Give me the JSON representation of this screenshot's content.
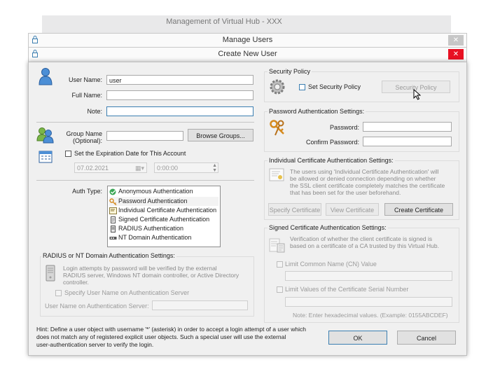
{
  "windows": {
    "bg_title": "Management of Virtual Hub - XXX",
    "mid_title": "Manage Users",
    "dialog_title": "Create New User",
    "close_glyph": "✕"
  },
  "user": {
    "user_name_label": "User Name:",
    "user_name_value": "user",
    "full_name_label": "Full Name:",
    "full_name_value": "",
    "note_label": "Note:",
    "note_value": ""
  },
  "group": {
    "label_line1": "Group Name",
    "label_line2": "(Optional):",
    "value": "",
    "browse_label": "Browse Groups..."
  },
  "expiration": {
    "checkbox_label": "Set the Expiration Date for This Account",
    "date": "07.02.2021",
    "time": "0:00:00"
  },
  "auth": {
    "label": "Auth Type:",
    "options": [
      "Anonymous Authentication",
      "Password Authentication",
      "Individual Certificate Authentication",
      "Signed Certificate Authentication",
      "RADIUS Authentication",
      "NT Domain Authentication"
    ]
  },
  "radius": {
    "group_title": "RADIUS or NT Domain Authentication Settings:",
    "description": [
      "Login attempts by password will be verified by the external",
      "RADIUS server, Windows NT domain controller, or Active Directory",
      "controller."
    ],
    "specify_label": "Specify User Name on Authentication Server",
    "user_label": "User Name on Authentication Server:"
  },
  "hint": {
    "lines": [
      "Hint: Define a user object with username '*' (asterisk) in order to accept a login attempt of a user which",
      "does not match any of registered explicit user objects. Such a special user will use the external",
      "user-authentication server to verify the login."
    ]
  },
  "security": {
    "group_title": "Security Policy",
    "checkbox_label": "Set Security Policy",
    "button_label": "Security Policy"
  },
  "password": {
    "group_title": "Password Authentication Settings:",
    "password_label": "Password:",
    "confirm_label": "Confirm Password:"
  },
  "individual_cert": {
    "group_title": "Individual Certificate Authentication Settings:",
    "description": [
      "The users using 'Individual Certificate Authentication' will",
      "be allowed or denied connection depending on whether",
      "the SSL client certificate completely matches the certificate",
      "that has been set for the user beforehand."
    ],
    "specify_label": "Specify Certificate",
    "view_label": "View Certificate",
    "create_label": "Create Certificate"
  },
  "signed_cert": {
    "group_title": "Signed Certificate Authentication Settings:",
    "description": [
      "Verification of whether the client certificate is signed is",
      "based on a certificate of a CA trusted by this Virtual Hub."
    ],
    "cn_label": "Limit Common Name (CN) Value",
    "serial_label": "Limit Values of the Certificate Serial Number",
    "note": "Note: Enter hexadecimal values. (Example: 0155ABCDEF)"
  },
  "buttons": {
    "ok": "OK",
    "cancel": "Cancel"
  },
  "colors": {
    "close_red": "#e81123",
    "close_gray": "#c7c7c7",
    "focus_blue": "#3c7fb1",
    "auth_icon_orange": "#d58a1e"
  }
}
